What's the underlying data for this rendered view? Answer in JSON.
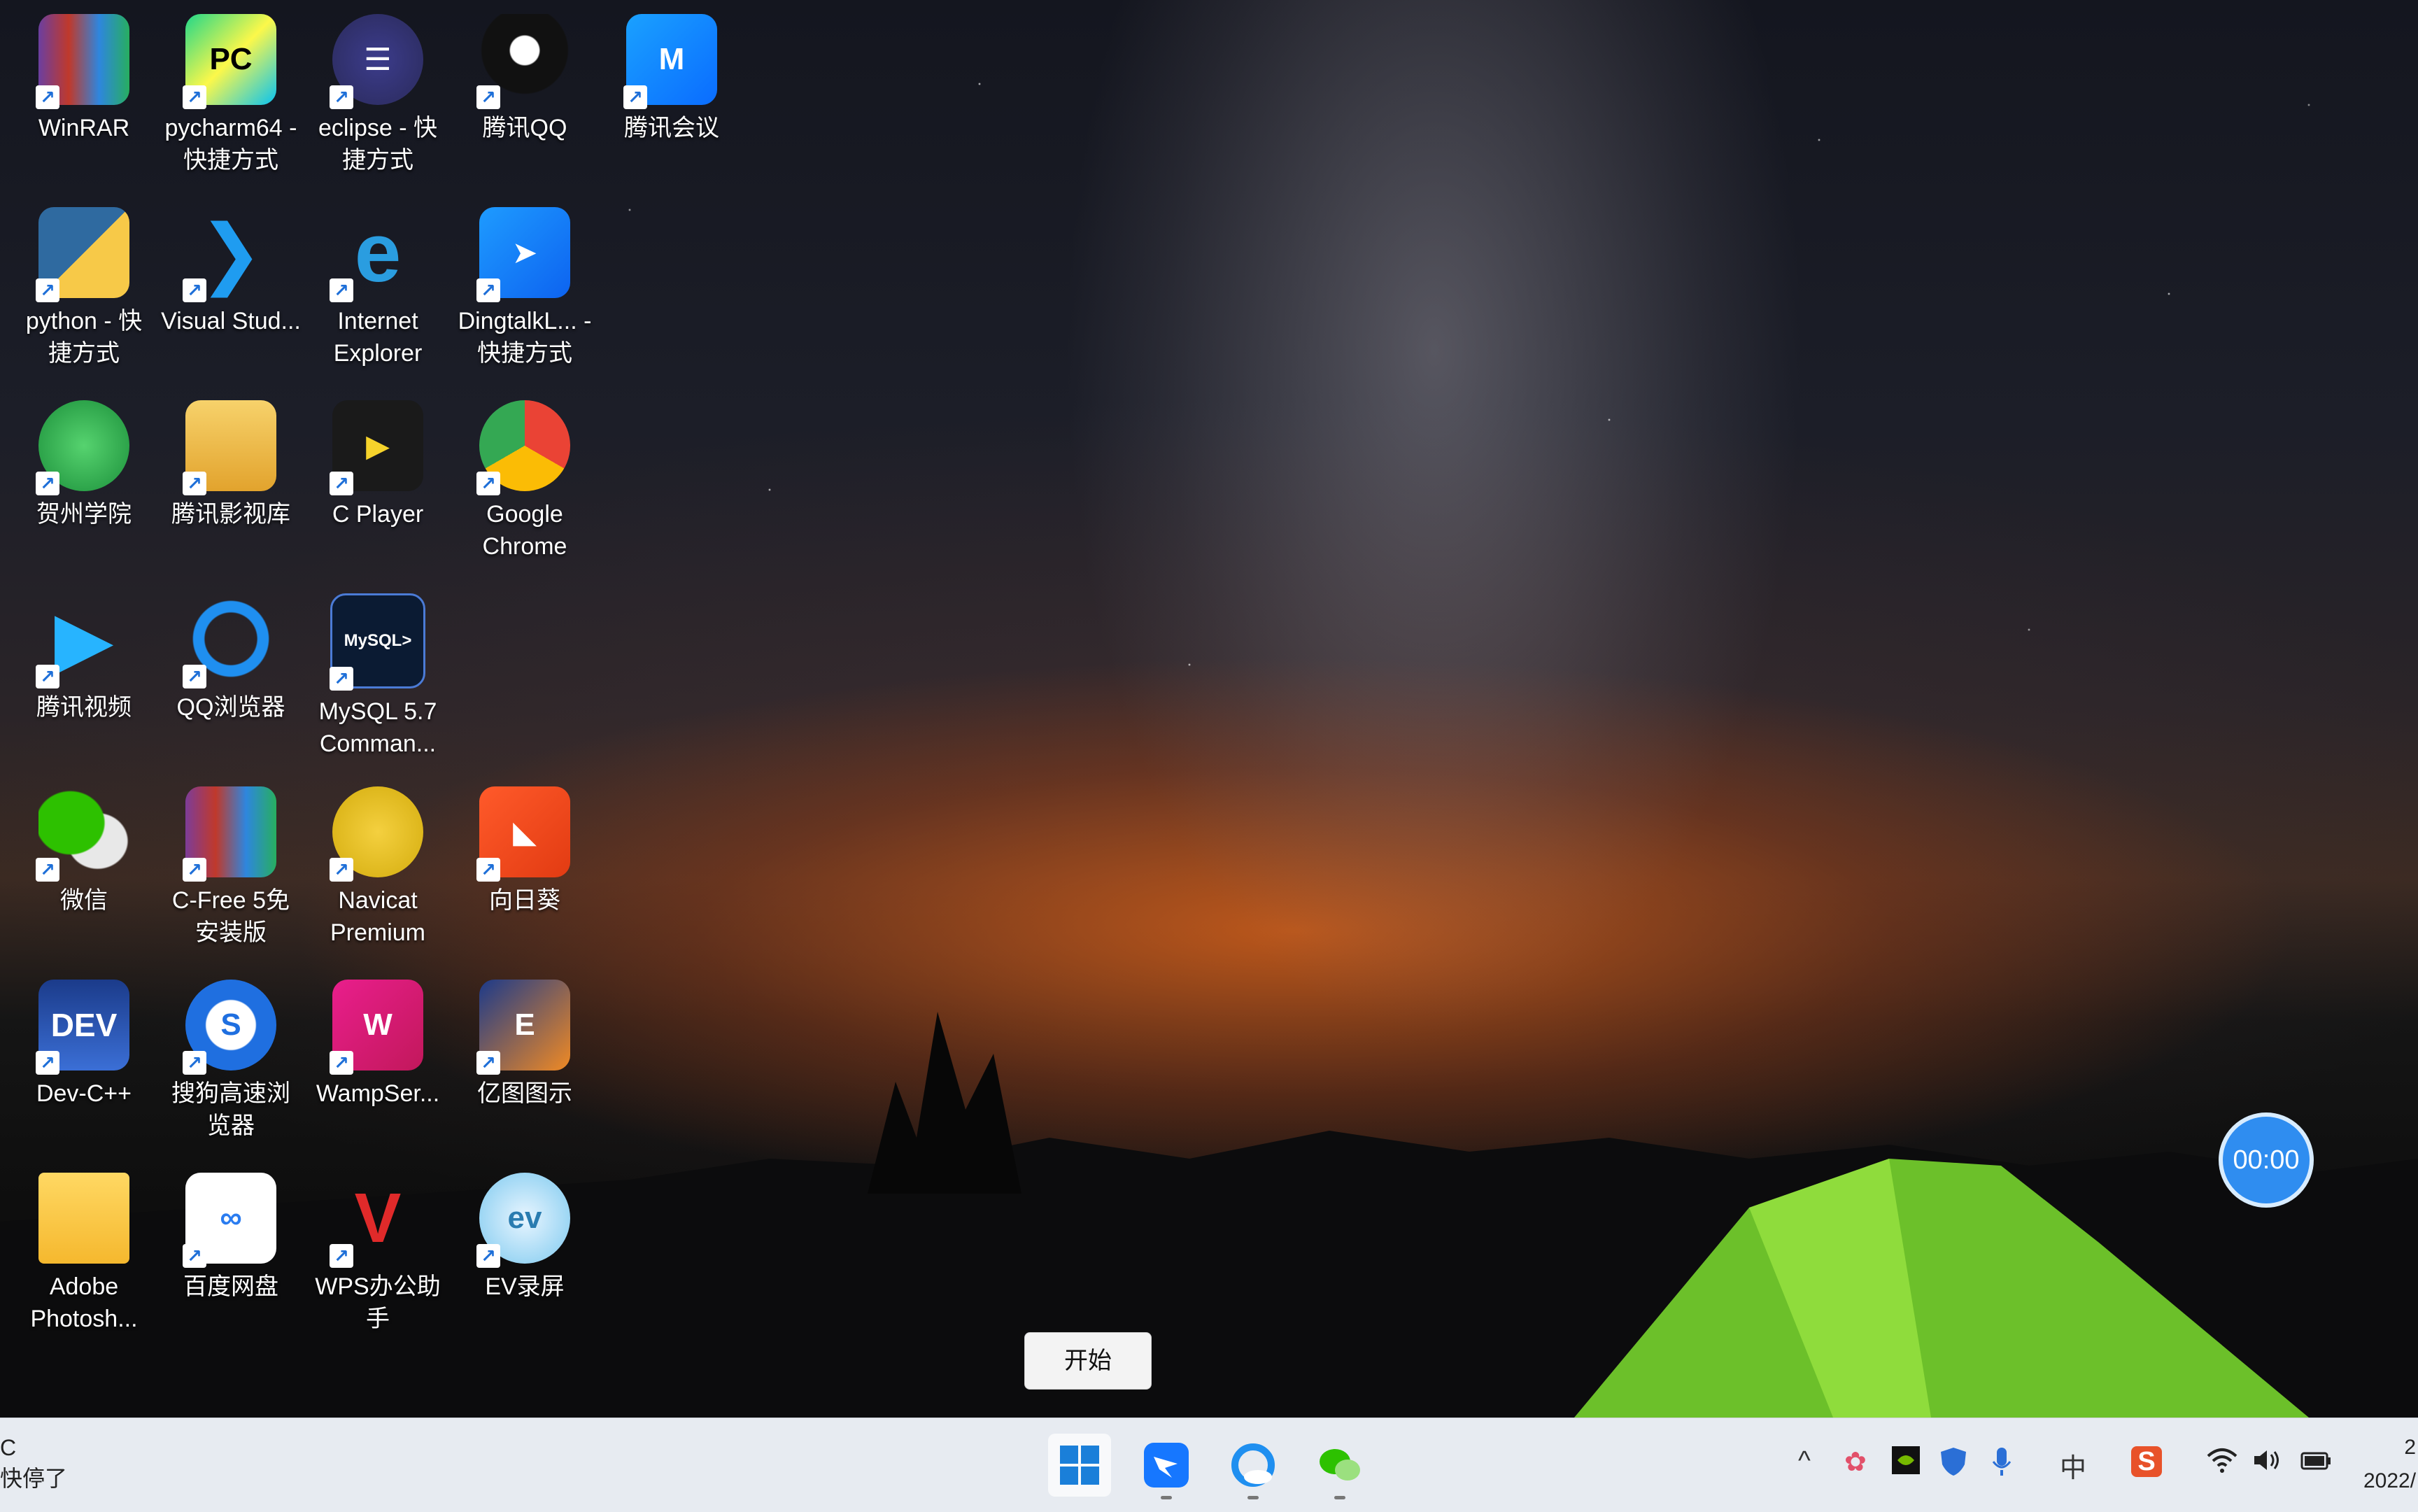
{
  "desktop": {
    "icons": [
      {
        "label": "WinRAR",
        "icon": "winrar-icon"
      },
      {
        "label": "pycharm64 - 快捷方式",
        "icon": "pycharm-icon"
      },
      {
        "label": "eclipse - 快捷方式",
        "icon": "eclipse-icon"
      },
      {
        "label": "腾讯QQ",
        "icon": "qq-icon"
      },
      {
        "label": "腾讯会议",
        "icon": "tencent-meeting-icon"
      },
      {
        "label": "python - 快捷方式",
        "icon": "python-icon"
      },
      {
        "label": "Visual Stud...",
        "icon": "vscode-icon"
      },
      {
        "label": "Internet Explorer",
        "icon": "ie-icon"
      },
      {
        "label": "DingtalkL... - 快捷方式",
        "icon": "dingtalk-icon"
      },
      {
        "label": "贺州学院",
        "icon": "hezhou-icon"
      },
      {
        "label": "腾讯影视库",
        "icon": "tencent-video-library-icon"
      },
      {
        "label": "C Player",
        "icon": "cplayer-icon"
      },
      {
        "label": "Google Chrome",
        "icon": "chrome-icon"
      },
      {
        "label": "腾讯视频",
        "icon": "tencent-video-icon"
      },
      {
        "label": "QQ浏览器",
        "icon": "qq-browser-icon"
      },
      {
        "label": "MySQL 5.7 Comman...",
        "icon": "mysql-icon"
      },
      {
        "label": "微信",
        "icon": "wechat-icon"
      },
      {
        "label": "C-Free 5免安装版",
        "icon": "cfree-icon"
      },
      {
        "label": "Navicat Premium",
        "icon": "navicat-icon"
      },
      {
        "label": "向日葵",
        "icon": "sunlogin-icon"
      },
      {
        "label": "Dev-C++",
        "icon": "devcpp-icon"
      },
      {
        "label": "搜狗高速浏览器",
        "icon": "sogou-browser-icon"
      },
      {
        "label": "WampSer...",
        "icon": "wampserver-icon"
      },
      {
        "label": "亿图图示",
        "icon": "edraw-icon"
      },
      {
        "label": "Adobe Photosh...",
        "icon": "folder-icon"
      },
      {
        "label": "百度网盘",
        "icon": "baidu-netdisk-icon"
      },
      {
        "label": "WPS办公助手",
        "icon": "wps-icon"
      },
      {
        "label": "EV录屏",
        "icon": "ev-recorder-icon"
      }
    ]
  },
  "tooltip": {
    "text": "开始"
  },
  "timer": {
    "text": "00:00"
  },
  "taskbar": {
    "left_line1": "C",
    "left_line2": "快停了",
    "apps": [
      {
        "name": "start-button",
        "icon": "windows-icon"
      },
      {
        "name": "dingtalk",
        "icon": "dingtalk-icon"
      },
      {
        "name": "qq-browser",
        "icon": "qq-browser-icon"
      },
      {
        "name": "wechat",
        "icon": "wechat-icon"
      }
    ],
    "tray": {
      "chevron": "^",
      "ime_label": "中",
      "sogou_label": "S"
    },
    "clock": {
      "line1": "2",
      "line2": "2022/"
    }
  }
}
